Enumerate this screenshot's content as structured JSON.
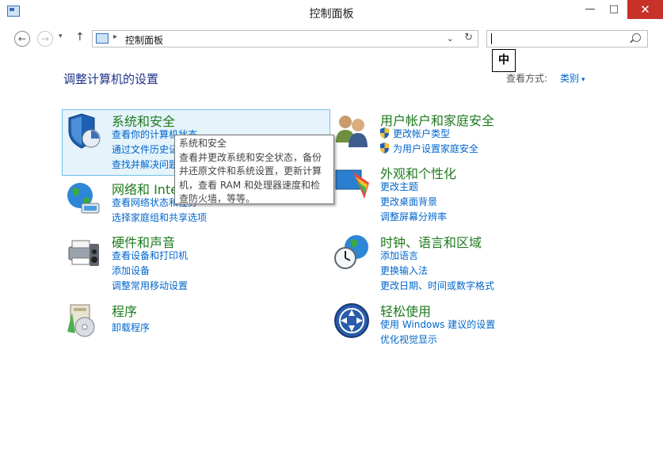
{
  "window": {
    "title": "控制面板",
    "controls": {
      "minimize": "—",
      "maximize": "□",
      "close": "✕"
    }
  },
  "nav": {
    "back": "←",
    "forward": "→",
    "recent": "▾",
    "up": "↑",
    "address": {
      "separator": "▸",
      "location": "控制面板",
      "dropdown": "⌄",
      "refresh": "↻"
    },
    "search": {
      "value": "",
      "placeholder": ""
    }
  },
  "ime": {
    "label": "中"
  },
  "page": {
    "heading": "调整计算机的设置",
    "view_by_label": "查看方式:",
    "view_by_value": "类别",
    "view_by_caret": "▾"
  },
  "categories": {
    "system_security": {
      "title": "系统和安全",
      "links": [
        "查看你的计算机状态",
        "通过文件历史记录保存你的文件备份副本",
        "查找并解决问题"
      ]
    },
    "network": {
      "title": "网络和 Internet",
      "links": [
        "查看网络状态和任务",
        "选择家庭组和共享选项"
      ]
    },
    "hardware": {
      "title": "硬件和声音",
      "links": [
        "查看设备和打印机",
        "添加设备",
        "调整常用移动设置"
      ]
    },
    "programs": {
      "title": "程序",
      "links": [
        "卸载程序"
      ]
    },
    "user_accounts": {
      "title": "用户帐户和家庭安全",
      "links": [
        "更改帐户类型",
        "为用户设置家庭安全"
      ]
    },
    "appearance": {
      "title": "外观和个性化",
      "links": [
        "更改主题",
        "更改桌面背景",
        "调整屏幕分辨率"
      ]
    },
    "clock_region": {
      "title": "时钟、语言和区域",
      "links": [
        "添加语言",
        "更换输入法",
        "更改日期、时间或数字格式"
      ]
    },
    "ease_of_access": {
      "title": "轻松使用",
      "links": [
        "使用 Windows 建议的设置",
        "优化视觉显示"
      ]
    }
  },
  "tooltip": {
    "title": "系统和安全",
    "body": "查看并更改系统和安全状态，备份并还原文件和系统设置，更新计算机，查看 RAM 和处理器速度和检查防火墙，等等。"
  },
  "colors": {
    "heading": "#1e3287",
    "category_title": "#1e7a1e",
    "link": "#0066cc",
    "hover_bg": "#e5f3fb",
    "hover_border": "#70c0e7",
    "close_button": "#c7312a"
  }
}
